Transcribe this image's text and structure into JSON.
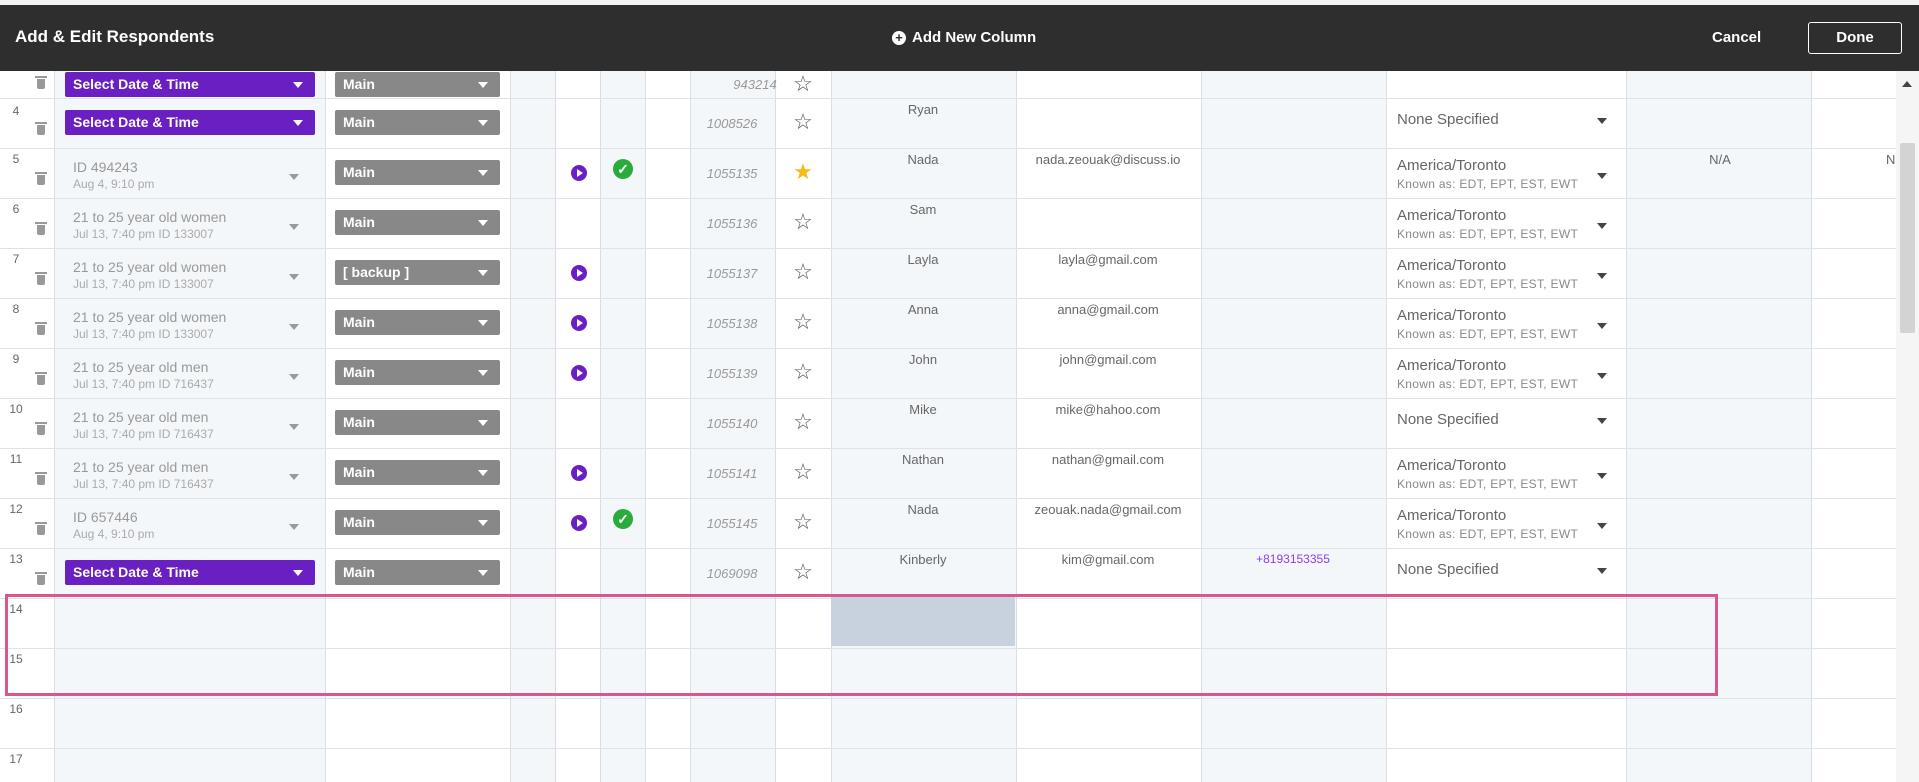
{
  "header": {
    "title": "Add & Edit Respondents",
    "add_column": "Add New Column",
    "cancel": "Cancel",
    "done": "Done"
  },
  "rows": [
    {
      "num": "",
      "schedule_select": "Select Date & Time",
      "group": "Main",
      "id": "943214"
    },
    {
      "num": "4",
      "schedule_select": "Select Date & Time",
      "group": "Main",
      "id": "1008526",
      "name": "Ryan",
      "tz": "None Specified"
    },
    {
      "num": "5",
      "schedule": "ID 494243",
      "schedule_sub": "Aug 4, 9:10 pm",
      "group": "Main",
      "id": "1055135",
      "name": "Nada",
      "email": "nada.zeouak@discuss.io",
      "tz": "America/Toronto",
      "tz_sub": "Known as: EDT, EPT, EST, EWT",
      "extra1": "N/A",
      "extra2": "N"
    },
    {
      "num": "6",
      "schedule": "21 to 25 year old women",
      "schedule_sub": "Jul 13, 7:40 pm    ID 133007",
      "group": "Main",
      "id": "1055136",
      "name": "Sam",
      "tz": "America/Toronto",
      "tz_sub": "Known as: EDT, EPT, EST, EWT"
    },
    {
      "num": "7",
      "schedule": "21 to 25 year old women",
      "schedule_sub": "Jul 13, 7:40 pm    ID 133007",
      "group": "[ backup ]",
      "id": "1055137",
      "name": "Layla",
      "email": "layla@gmail.com",
      "tz": "America/Toronto",
      "tz_sub": "Known as: EDT, EPT, EST, EWT"
    },
    {
      "num": "8",
      "schedule": "21 to 25 year old women",
      "schedule_sub": "Jul 13, 7:40 pm    ID 133007",
      "group": "Main",
      "id": "1055138",
      "name": "Anna",
      "email": "anna@gmail.com",
      "tz": "America/Toronto",
      "tz_sub": "Known as: EDT, EPT, EST, EWT"
    },
    {
      "num": "9",
      "schedule": "21 to 25 year old men",
      "schedule_sub": "Jul 13, 7:40 pm   ID 716437",
      "group": "Main",
      "id": "1055139",
      "name": "John",
      "email": "john@gmail.com",
      "tz": "America/Toronto",
      "tz_sub": "Known as: EDT, EPT, EST, EWT"
    },
    {
      "num": "10",
      "schedule": "21 to 25 year old men",
      "schedule_sub": "Jul 13, 7:40 pm   ID 716437",
      "group": "Main",
      "id": "1055140",
      "name": "Mike",
      "email": "mike@hahoo.com",
      "tz": "None Specified"
    },
    {
      "num": "11",
      "schedule": "21 to 25 year old men",
      "schedule_sub": "Jul 13, 7:40 pm   ID 716437",
      "group": "Main",
      "id": "1055141",
      "name": "Nathan",
      "email": "nathan@gmail.com",
      "tz": "America/Toronto",
      "tz_sub": "Known as: EDT, EPT, EST, EWT"
    },
    {
      "num": "12",
      "schedule": "ID 657446",
      "schedule_sub": "Aug 4, 9:10 pm",
      "group": "Main",
      "id": "1055145",
      "name": "Nada",
      "email": "zeouak.nada@gmail.com",
      "tz": "America/Toronto",
      "tz_sub": "Known as: EDT, EPT, EST, EWT"
    },
    {
      "num": "13",
      "schedule_select": "Select Date & Time",
      "group": "Main",
      "id": "1069098",
      "name": "Kinberly",
      "email": "kim@gmail.com",
      "phone": "+8193153355",
      "tz": "None Specified"
    },
    {
      "num": "14"
    },
    {
      "num": "15"
    },
    {
      "num": "16"
    },
    {
      "num": "17"
    }
  ],
  "colors": {
    "header_bg": "#2e2e2e",
    "accent_purple": "#6a1fc2",
    "select_gray": "#888888",
    "selection_border": "#d9578e",
    "check_green": "#2bab3c",
    "star_gold": "#f5b918"
  }
}
